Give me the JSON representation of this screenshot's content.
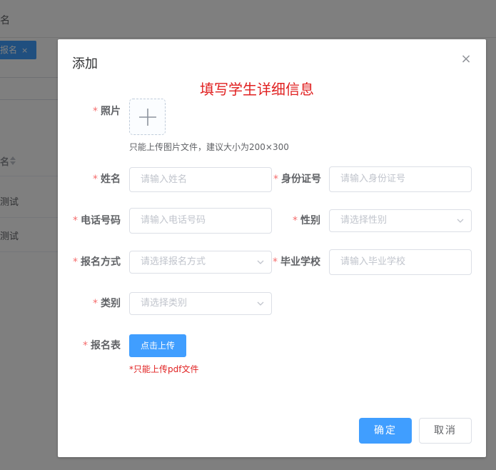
{
  "background": {
    "header_text": "名",
    "tag_label": "报名",
    "tag_close": "×",
    "table_header": "名",
    "rows": [
      "测试",
      "测试"
    ]
  },
  "dialog": {
    "title": "添加",
    "close": "×",
    "heading": "填写学生详细信息",
    "required_mark": "*",
    "photo": {
      "label": "照片",
      "tip": "只能上传图片文件，建议大小为200×300"
    },
    "fields": {
      "name": {
        "label": "姓名",
        "placeholder": "请输入姓名"
      },
      "id_card": {
        "label": "身份证号",
        "placeholder": "请输入身份证号"
      },
      "phone": {
        "label": "电话号码",
        "placeholder": "请输入电话号码"
      },
      "gender": {
        "label": "性别",
        "placeholder": "请选择性别"
      },
      "signup_method": {
        "label": "报名方式",
        "placeholder": "请选择报名方式"
      },
      "school": {
        "label": "毕业学校",
        "placeholder": "请输入毕业学校"
      },
      "category": {
        "label": "类别",
        "placeholder": "请选择类别"
      }
    },
    "form_file": {
      "label": "报名表",
      "button": "点击上传",
      "note": "*只能上传pdf文件"
    },
    "buttons": {
      "confirm": "确定",
      "cancel": "取消"
    }
  },
  "colors": {
    "primary": "#409eff",
    "danger_text": "#e02020",
    "required": "#f56c6c"
  },
  "icons": {
    "upload": "plus-icon",
    "select": "chevron-down-icon",
    "close": "close-icon",
    "sort": "sort-icon"
  }
}
